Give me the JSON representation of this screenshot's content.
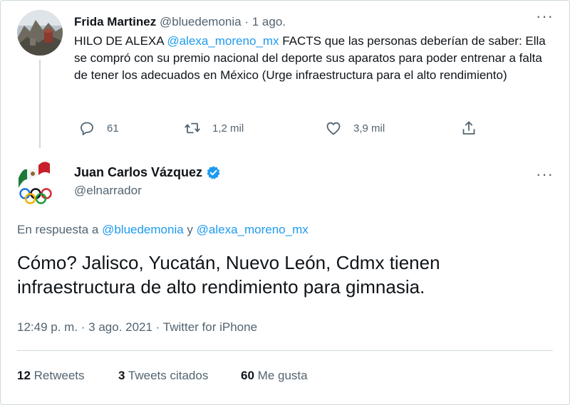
{
  "parent_tweet": {
    "display_name": "Frida Martinez",
    "handle": "@bluedemonia",
    "separator": "·",
    "time": "1 ago.",
    "text_prefix": "HILO DE ALEXA ",
    "mention": "@alexa_moreno_mx",
    "text_suffix": "  FACTS que las personas deberían de saber: Ella se compró con su premio nacional del deporte sus aparatos para poder entrenar a falta de tener los adecuados en México (Urge infraestructura para el alto rendimiento)",
    "more": "···",
    "actions": {
      "reply_count": "61",
      "retweet_count": "1,2 mil",
      "like_count": "3,9 mil"
    },
    "icons": [
      "reply-icon",
      "retweet-icon",
      "like-icon",
      "share-icon"
    ]
  },
  "main_tweet": {
    "display_name": "Juan Carlos Vázquez",
    "handle": "@elnarrador",
    "more": "···",
    "reply_prefix": "En respuesta a ",
    "reply_mention_1": "@bluedemonia",
    "reply_joiner": " y ",
    "reply_mention_2": "@alexa_moreno_mx",
    "text": "Cómo? Jalisco, Yucatán, Nuevo León, Cdmx tienen infraestructura de alto rendimiento para gimnasia.",
    "meta": "12:49 p. m. · 3 ago. 2021 · Twitter for iPhone",
    "stats": {
      "retweets_num": "12",
      "retweets_label": "Retweets",
      "quotes_num": "3",
      "quotes_label": "Tweets citados",
      "likes_num": "60",
      "likes_label": "Me gusta"
    }
  },
  "colors": {
    "accent": "#1d9bf0",
    "secondary_text": "#536471",
    "primary_text": "#0f1419",
    "border": "#cfd9de"
  }
}
